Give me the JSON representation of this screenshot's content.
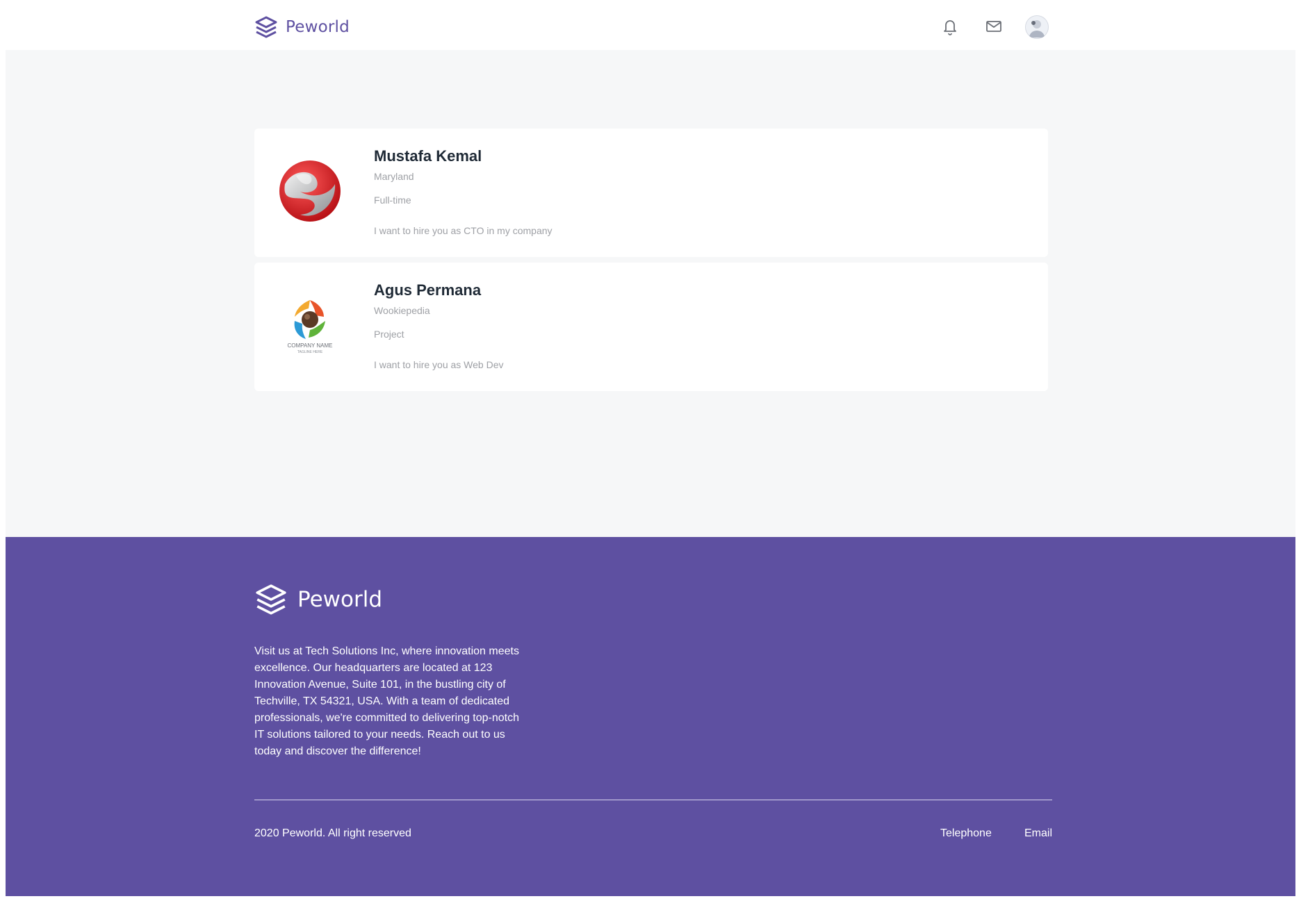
{
  "header": {
    "brand": "Peworld",
    "icons": [
      "bell-icon",
      "mail-icon"
    ],
    "avatar": "user-avatar"
  },
  "offers": [
    {
      "name": "Mustafa Kemal",
      "location": "Maryland",
      "job_type": "Full-time",
      "message": "I want to hire you as CTO in my company",
      "logo": "red-silver-swirl-logo"
    },
    {
      "name": "Agus Permana",
      "location": "Wookiepedia",
      "job_type": "Project",
      "message": "I want to hire you as Web Dev",
      "logo": "company-name-logo",
      "logo_text": "COMPANY NAME",
      "logo_tagline": "TAGLINE HERE"
    }
  ],
  "footer": {
    "brand": "Peworld",
    "description": "Visit us at Tech Solutions Inc, where innovation meets excellence. Our headquarters are located at 123 Innovation Avenue, Suite 101, in the bustling city of Techville, TX 54321, USA. With a team of dedicated professionals, we're committed to delivering top-notch IT solutions tailored to your needs. Reach out to us today and discover the difference!",
    "copyright": "2020 Peworld. All right reserved",
    "links": [
      "Telephone",
      "Email"
    ]
  },
  "colors": {
    "brand": "#5e50a1",
    "background": "#f6f7f8",
    "card": "#ffffff",
    "muted_text": "#9ea0a5",
    "heading_text": "#1f2a36"
  }
}
